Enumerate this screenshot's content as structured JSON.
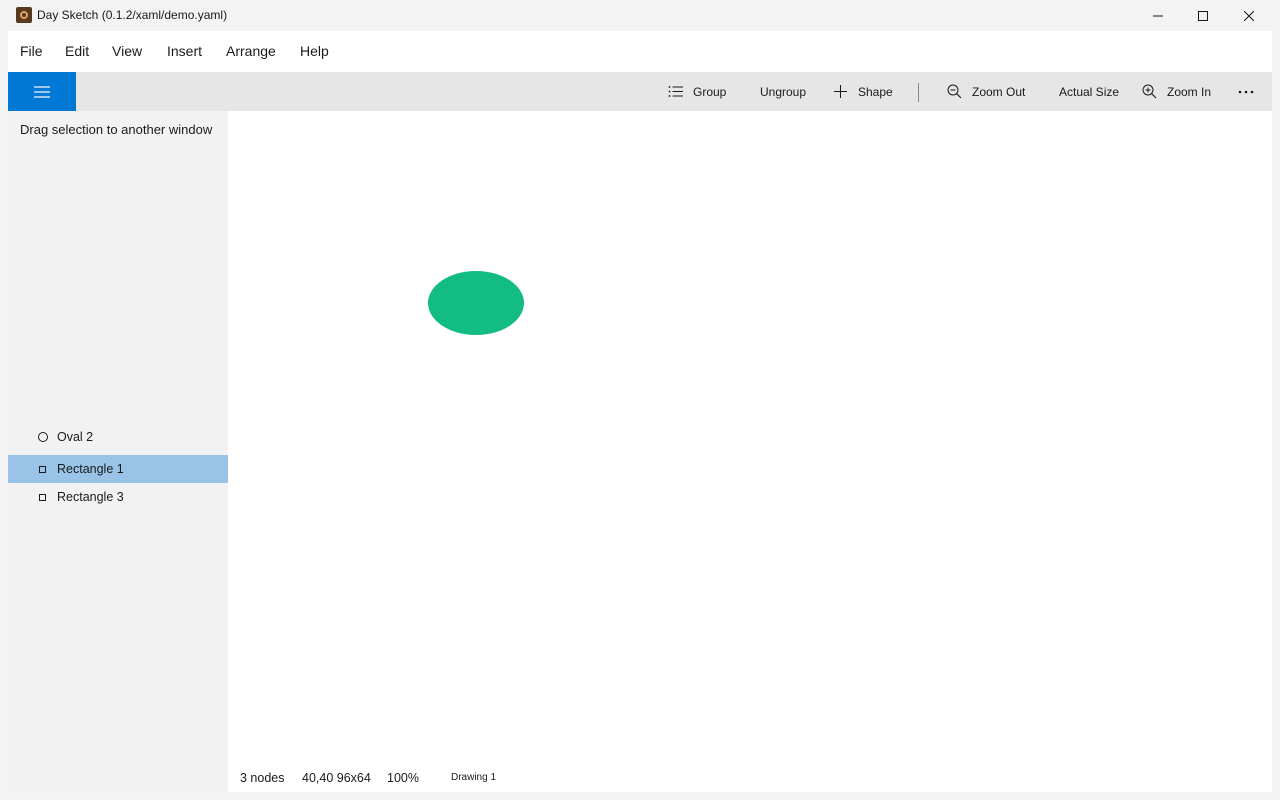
{
  "window": {
    "title": "Day Sketch (0.1.2/xaml/demo.yaml)"
  },
  "menu": [
    "File",
    "Edit",
    "View",
    "Insert",
    "Arrange",
    "Help"
  ],
  "toolbar": {
    "group_label": "Group",
    "ungroup_label": "Ungroup",
    "shape_label": "Shape",
    "zoom_out_label": "Zoom Out",
    "actual_size_label": "Actual Size",
    "zoom_in_label": "Zoom In",
    "more_icon": "more-icon"
  },
  "left_panel": {
    "drag_hint": "Drag selection to another window",
    "nodes": [
      {
        "label": "Oval 2",
        "icon": "oval-icon",
        "selected": false
      },
      {
        "label": "Rectangle 1",
        "icon": "rectangle-icon",
        "selected": true
      },
      {
        "label": "Rectangle 3",
        "icon": "rectangle-icon",
        "selected": false
      }
    ]
  },
  "canvas": {
    "oval_color": "#12bc82",
    "accent_color": "#0078d4",
    "selection_color": "#99c4e8"
  },
  "status": {
    "node_count": "3 nodes",
    "selection_geometry": "40,40 96x64",
    "zoom": "100%",
    "drawing_name": "Drawing 1"
  }
}
